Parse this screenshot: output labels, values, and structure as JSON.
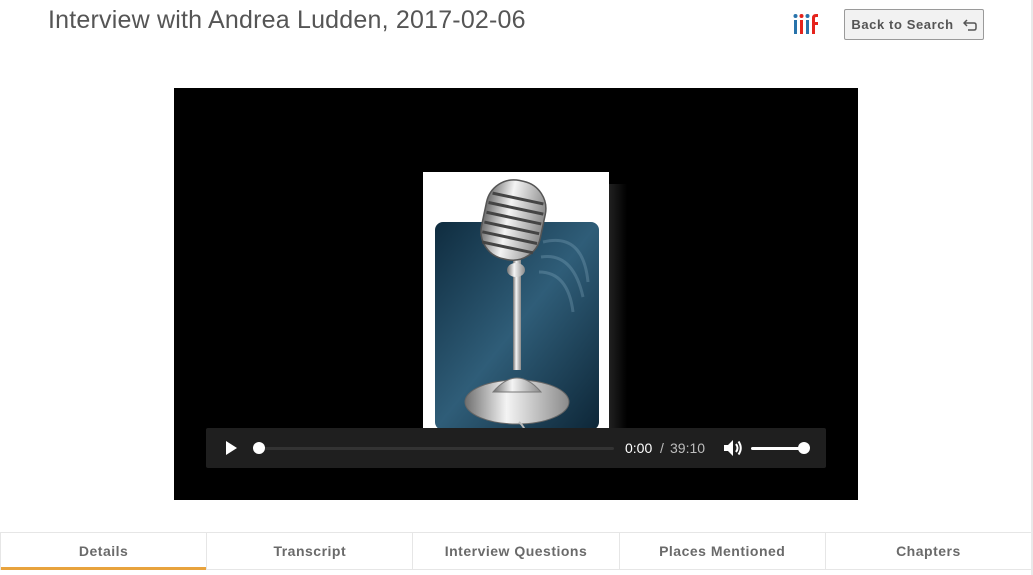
{
  "header": {
    "title": "Interview with Andrea Ludden, 2017-02-06",
    "iiif_logo_icon": "iiif-logo-icon",
    "back_label": "Back to Search",
    "back_icon": "return-arrow-icon"
  },
  "player": {
    "poster_icon": "microphone-icon",
    "play_icon": "play-icon",
    "current_time": "0:00",
    "separator": "/",
    "duration": "39:10",
    "progress_fraction": 0,
    "volume_icon": "volume-icon",
    "volume_fraction": 1.0
  },
  "tabs": [
    {
      "label": "Details",
      "active": true
    },
    {
      "label": "Transcript",
      "active": false
    },
    {
      "label": "Interview Questions",
      "active": false
    },
    {
      "label": "Places Mentioned",
      "active": false
    },
    {
      "label": "Chapters",
      "active": false
    }
  ],
  "colors": {
    "active_tab_underline": "#e8a33d",
    "iiif_red": "#e5231c",
    "iiif_blue": "#2873ab"
  }
}
